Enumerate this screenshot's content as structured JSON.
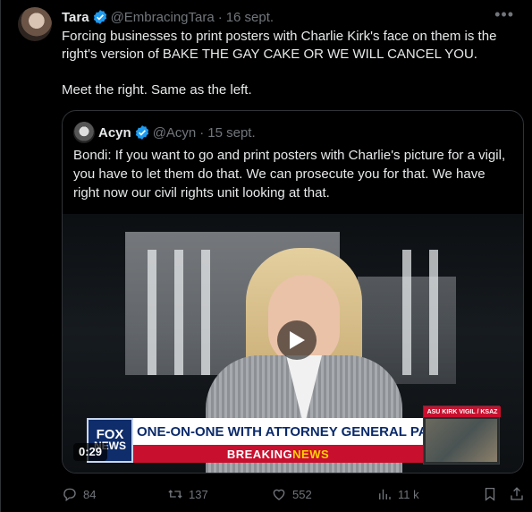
{
  "author": {
    "name": "Tara",
    "handle": "@EmbracingTara",
    "date": "16 sept."
  },
  "tweet_text": {
    "line1": "Forcing businesses to print posters with Charlie Kirk's face on them is the right's version of BAKE THE GAY CAKE OR WE WILL CANCEL YOU.",
    "line2": "Meet the right. Same as the left."
  },
  "quoted": {
    "name": "Acyn",
    "handle": "@Acyn",
    "date": "15 sept.",
    "text": "Bondi: If you want to go and print posters with Charlie's picture for a vigil, you have to let them do that. We can prosecute you for that. We have right now our civil rights unit looking at that.",
    "video": {
      "duration": "0:29",
      "chyron_top": "ONE-ON-ONE WITH ATTORNEY GENERAL PAM BONDI",
      "chyron_bottom_a": "BREAKING ",
      "chyron_bottom_b": "NEWS",
      "logo_line1": "FOX",
      "logo_line2": "NEWS",
      "side_label": "ASU KIRK VIGIL / KSAZ"
    }
  },
  "actions": {
    "replies": "84",
    "reposts": "137",
    "likes": "552",
    "views": "11 k"
  },
  "colors": {
    "background": "#000000",
    "text": "#e7e9ea",
    "muted": "#71767b",
    "verified": "#1d9bf0",
    "border": "#2f3336"
  }
}
